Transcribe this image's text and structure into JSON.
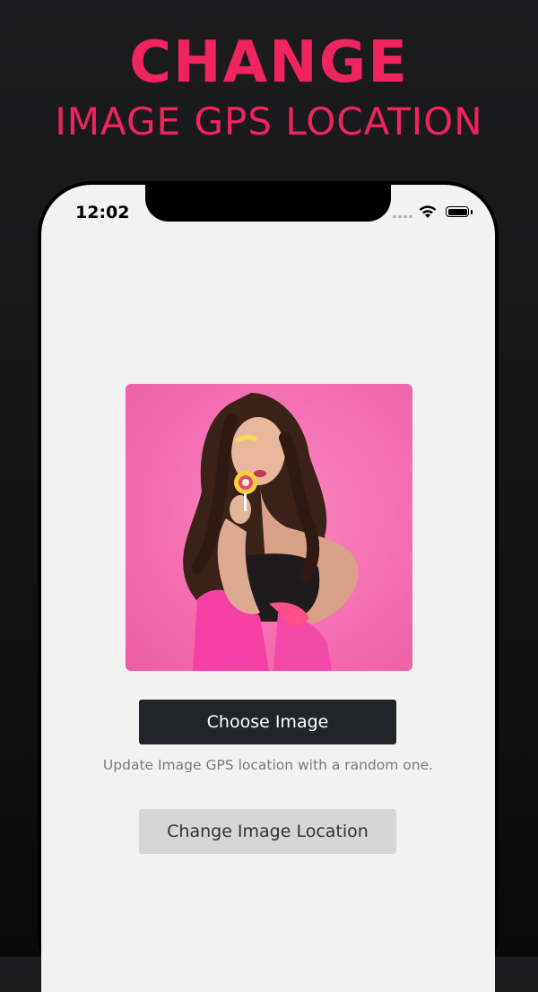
{
  "promo": {
    "headline_line1": "CHANGE",
    "headline_line2": "IMAGE GPS LOCATION",
    "accent_color": "#f0245e"
  },
  "status_bar": {
    "time": "12:02",
    "icons": [
      "cellular-signal-icon",
      "wifi-icon",
      "battery-icon"
    ]
  },
  "main": {
    "photo_alt": "selected photo",
    "choose_button_label": "Choose Image",
    "hint_text": "Update Image GPS location with a random one.",
    "change_button_label": "Change Image Location"
  }
}
